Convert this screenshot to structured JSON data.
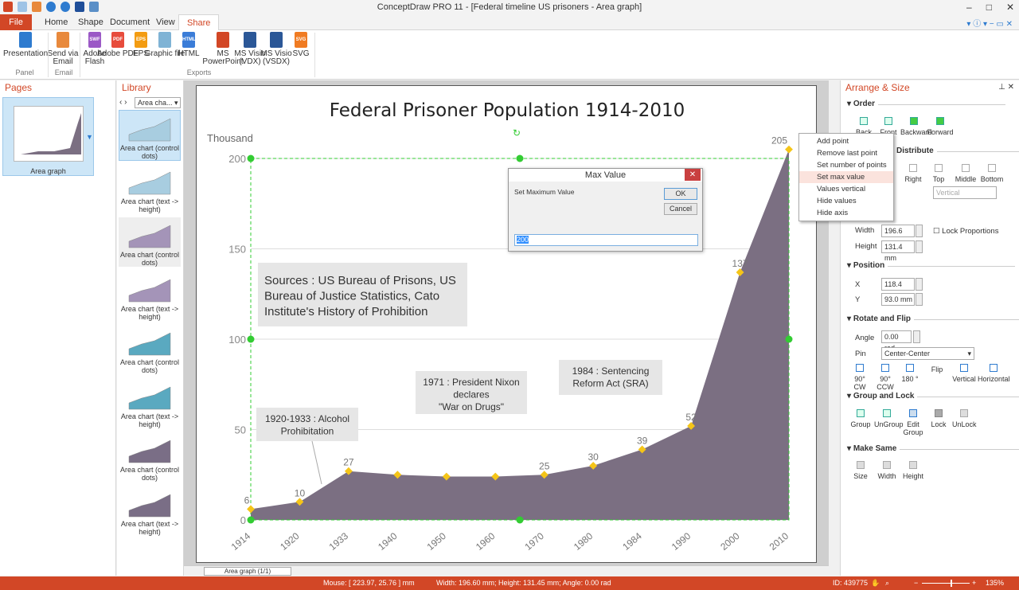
{
  "app": {
    "title": "ConceptDraw PRO 11 - [Federal timeline US prisoners - Area graph]"
  },
  "ribbon": {
    "tabs": [
      "File",
      "Home",
      "Shape",
      "Document",
      "View",
      "Share"
    ],
    "active_tab": "Share",
    "buttons": [
      {
        "label": "Presentation",
        "icon": "presentation-icon",
        "color": "#2e7bcf"
      },
      {
        "label": "Send via Email",
        "icon": "email-icon",
        "color": "#e8893c"
      },
      {
        "label": "Adobe Flash",
        "icon": "swf-file-icon",
        "badge": "SWF",
        "color": "#9b59c6"
      },
      {
        "label": "Adobe PDF",
        "icon": "pdf-file-icon",
        "badge": "PDF",
        "color": "#e74c3c"
      },
      {
        "label": "EPS",
        "icon": "eps-file-icon",
        "badge": "EPS",
        "color": "#f39c12"
      },
      {
        "label": "Graphic file",
        "icon": "image-file-icon",
        "color": "#7fb3d5"
      },
      {
        "label": "HTML",
        "icon": "html-file-icon",
        "badge": "HTML",
        "color": "#3b7dd8"
      },
      {
        "label": "MS PowerPoint",
        "icon": "powerpoint-icon",
        "color": "#d24726"
      },
      {
        "label": "MS Visio (VDX)",
        "icon": "visio-vdx-icon",
        "color": "#2b5797"
      },
      {
        "label": "MS Visio (VSDX)",
        "icon": "visio-vsdx-icon",
        "color": "#2b5797"
      },
      {
        "label": "SVG",
        "icon": "svg-file-icon",
        "badge": "SVG",
        "color": "#f07b22"
      }
    ],
    "groups": [
      "Panel",
      "Email",
      "Exports"
    ]
  },
  "pages": {
    "title": "Pages",
    "items": [
      {
        "label": "Area graph"
      }
    ]
  },
  "library": {
    "title": "Library",
    "dropdown": "Area cha...",
    "items": [
      {
        "label": "Area chart (control dots)",
        "color": "#a8cde0"
      },
      {
        "label": "Area chart (text -> height)",
        "color": "#a8cde0"
      },
      {
        "label": "Area chart (control dots)",
        "color": "#a494b8"
      },
      {
        "label": "Area chart (text -> height)",
        "color": "#a494b8"
      },
      {
        "label": "Area chart (control dots)",
        "color": "#5aa9c0"
      },
      {
        "label": "Area chart (text -> height)",
        "color": "#5aa9c0"
      },
      {
        "label": "Area chart (control dots)",
        "color": "#7a6e86"
      },
      {
        "label": "Area chart (text -> height)",
        "color": "#7a6e86"
      }
    ]
  },
  "chart_data": {
    "type": "area",
    "title": "Federal Prisoner Population 1914-2010",
    "ylabel": "Thousand",
    "categories": [
      "1914",
      "1920",
      "1933",
      "1940",
      "1950",
      "1960",
      "1970",
      "1980",
      "1984",
      "1990",
      "2000",
      "2010"
    ],
    "values": [
      6,
      10,
      27,
      25,
      24,
      24,
      25,
      30,
      39,
      52,
      137,
      205
    ],
    "data_labels": [
      "6",
      "10",
      "27",
      "",
      "",
      "",
      "25",
      "30",
      "39",
      "52",
      "137",
      "205"
    ],
    "yticks": [
      0,
      50,
      100,
      150,
      200
    ],
    "ylim": [
      0,
      200
    ],
    "grid": true,
    "color": "#7b6f82",
    "annotations": [
      "Sources : US Bureau of Prisons, US Bureau of Justice Statistics, Cato Institute's History of Prohibition",
      "1920-1933 : Alcohol Prohibitation",
      "1971 : President Nixon declares \"War on Drugs\"",
      "1984 : Sentencing Reform Act (SRA)"
    ]
  },
  "context_menu": {
    "items": [
      "Add point",
      "Remove last point",
      "Set number of points",
      "Set max value",
      "Values vertical",
      "Hide values",
      "Hide axis"
    ],
    "highlighted": "Set max value"
  },
  "dialog": {
    "title": "Max Value",
    "prompt": "Set Maximum Value",
    "ok": "OK",
    "cancel": "Cancel",
    "value": "200"
  },
  "arrange": {
    "title": "Arrange & Size",
    "order": {
      "title": "Order",
      "buttons": [
        "Back",
        "Front",
        "Backward",
        "Forward"
      ]
    },
    "distribute": {
      "title": "Distribute",
      "buttons": [
        "Right",
        "Top",
        "Middle",
        "Bottom"
      ],
      "dropdown": "Vertical"
    },
    "size": {
      "width_label": "Width",
      "width": "196.6 mm",
      "height_label": "Height",
      "height": "131.4 mm",
      "lock": "Lock Proportions"
    },
    "position": {
      "title": "Position",
      "x_label": "X",
      "x": "118.4 mm",
      "y_label": "Y",
      "y": "93.0 mm"
    },
    "rotate": {
      "title": "Rotate and Flip",
      "angle_label": "Angle",
      "angle": "0.00 rad",
      "pin_label": "Pin",
      "pin": "Center-Center",
      "buttons": [
        "90° CW",
        "90° CCW",
        "180 °",
        "Flip",
        "Vertical",
        "Horizontal"
      ]
    },
    "group": {
      "title": "Group and Lock",
      "buttons": [
        "Group",
        "UnGroup",
        "Edit Group",
        "Lock",
        "UnLock"
      ]
    },
    "same": {
      "title": "Make Same",
      "buttons": [
        "Size",
        "Width",
        "Height"
      ]
    }
  },
  "bottom": {
    "page_tab": "Area graph (1/1)"
  },
  "status": {
    "mouse": "Mouse: [ 223.97, 25.76 ] mm",
    "dims": "Width: 196.60 mm;  Height: 131.45 mm;  Angle: 0.00 rad",
    "id": "ID: 439775",
    "zoom": "135%",
    "zoom_level": 0.6
  }
}
